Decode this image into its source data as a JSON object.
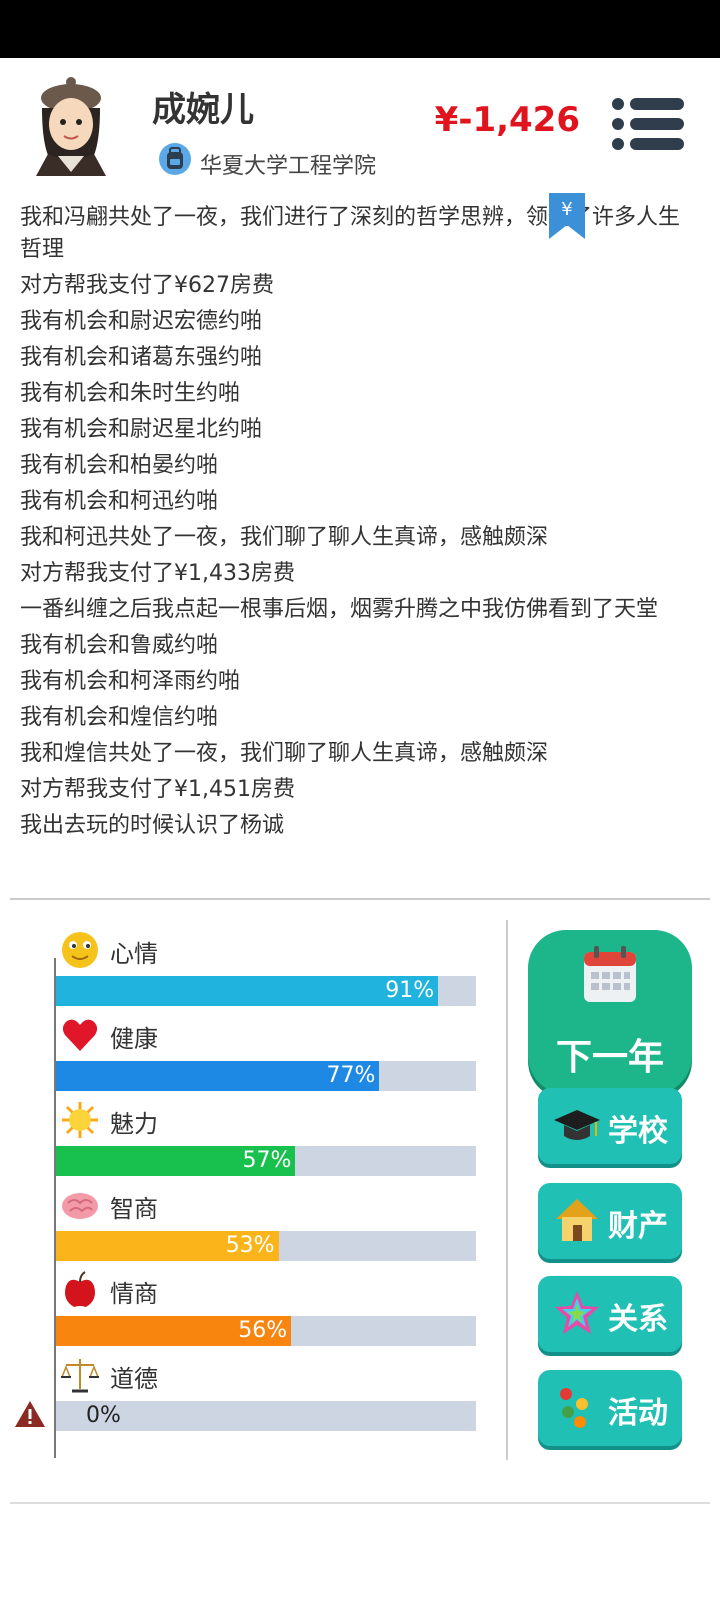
{
  "profile": {
    "name": "成婉儿",
    "school": "华夏大学工程学院",
    "money": "¥-1,426"
  },
  "bookmark_symbol": "¥",
  "log": [
    "我和冯翩共处了一夜，我们进行了深刻的哲学思辨，领悟了许多人生哲理",
    "对方帮我支付了¥627房费",
    "我有机会和尉迟宏德约啪",
    "我有机会和诸葛东强约啪",
    "我有机会和朱时生约啪",
    "我有机会和尉迟星北约啪",
    "我有机会和柏晏约啪",
    "我有机会和柯迅约啪",
    "我和柯迅共处了一夜，我们聊了聊人生真谛，感触颇深",
    "对方帮我支付了¥1,433房费",
    "一番纠缠之后我点起一根事后烟，烟雾升腾之中我仿佛看到了天堂",
    "我有机会和鲁威约啪",
    "我有机会和柯泽雨约啪",
    "我有机会和煌信约啪",
    "我和煌信共处了一夜，我们聊了聊人生真谛，感触颇深",
    "对方帮我支付了¥1,451房费",
    "我出去玩的时候认识了杨诚"
  ],
  "stats": [
    {
      "label": "心情",
      "value": 91,
      "text": "91%",
      "color": "#1fb3de",
      "icon": "smiley-icon"
    },
    {
      "label": "健康",
      "value": 77,
      "text": "77%",
      "color": "#1e88e5",
      "icon": "heart-icon"
    },
    {
      "label": "魅力",
      "value": 57,
      "text": "57%",
      "color": "#18c04e",
      "icon": "sun-icon"
    },
    {
      "label": "智商",
      "value": 53,
      "text": "53%",
      "color": "#fbb51a",
      "icon": "brain-icon"
    },
    {
      "label": "情商",
      "value": 56,
      "text": "56%",
      "color": "#f7850e",
      "icon": "apple-icon"
    },
    {
      "label": "道德",
      "value": 0,
      "text": "0%",
      "color": "#cdd5e2",
      "icon": "scales-icon"
    }
  ],
  "buttons": {
    "next_year": "下一年",
    "school": "学校",
    "property": "财产",
    "relations": "关系",
    "activity": "活动"
  }
}
